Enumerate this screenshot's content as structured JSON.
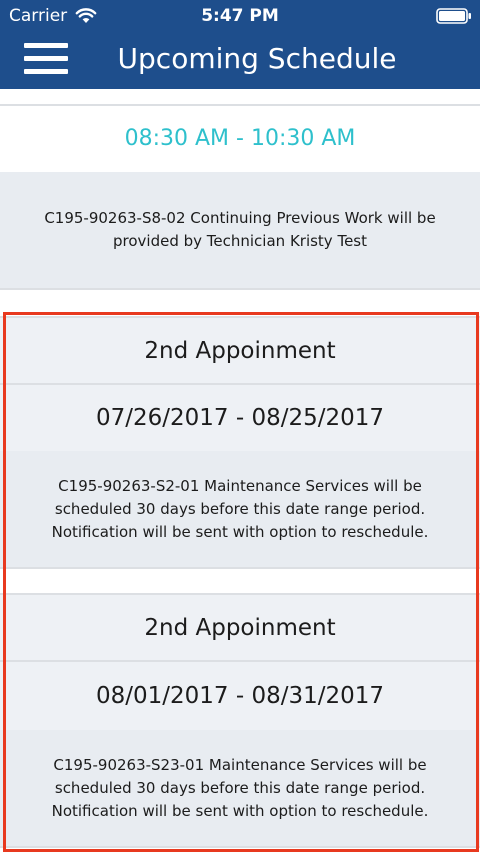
{
  "status_bar": {
    "carrier": "Carrier",
    "time": "5:47 PM",
    "wifi_icon": "wifi-icon",
    "battery_icon": "battery-icon"
  },
  "nav_bar": {
    "title": "Upcoming Schedule",
    "menu_icon": "hamburger-menu-icon"
  },
  "current_appointment": {
    "time_range": "08:30 AM - 10:30 AM",
    "description": "C195-90263-S8-02 Continuing Previous Work will be provided by Technician Kristy Test"
  },
  "appointments": [
    {
      "title": "2nd Appoinment",
      "date_range": "07/26/2017 - 08/25/2017",
      "description": "C195-90263-S2-01 Maintenance Services will be scheduled 30 days before this date range period. Notification will be sent with option to reschedule."
    },
    {
      "title": "2nd Appoinment",
      "date_range": "08/01/2017 - 08/31/2017",
      "description": "C195-90263-S23-01 Maintenance Services will be scheduled 30 days before this date range period. Notification will be sent with option to reschedule."
    }
  ],
  "colors": {
    "nav_background": "#1e4e8c",
    "time_accent": "#2ec0cc",
    "highlight_border": "#e8391f",
    "cell_background": "#eef1f5"
  }
}
